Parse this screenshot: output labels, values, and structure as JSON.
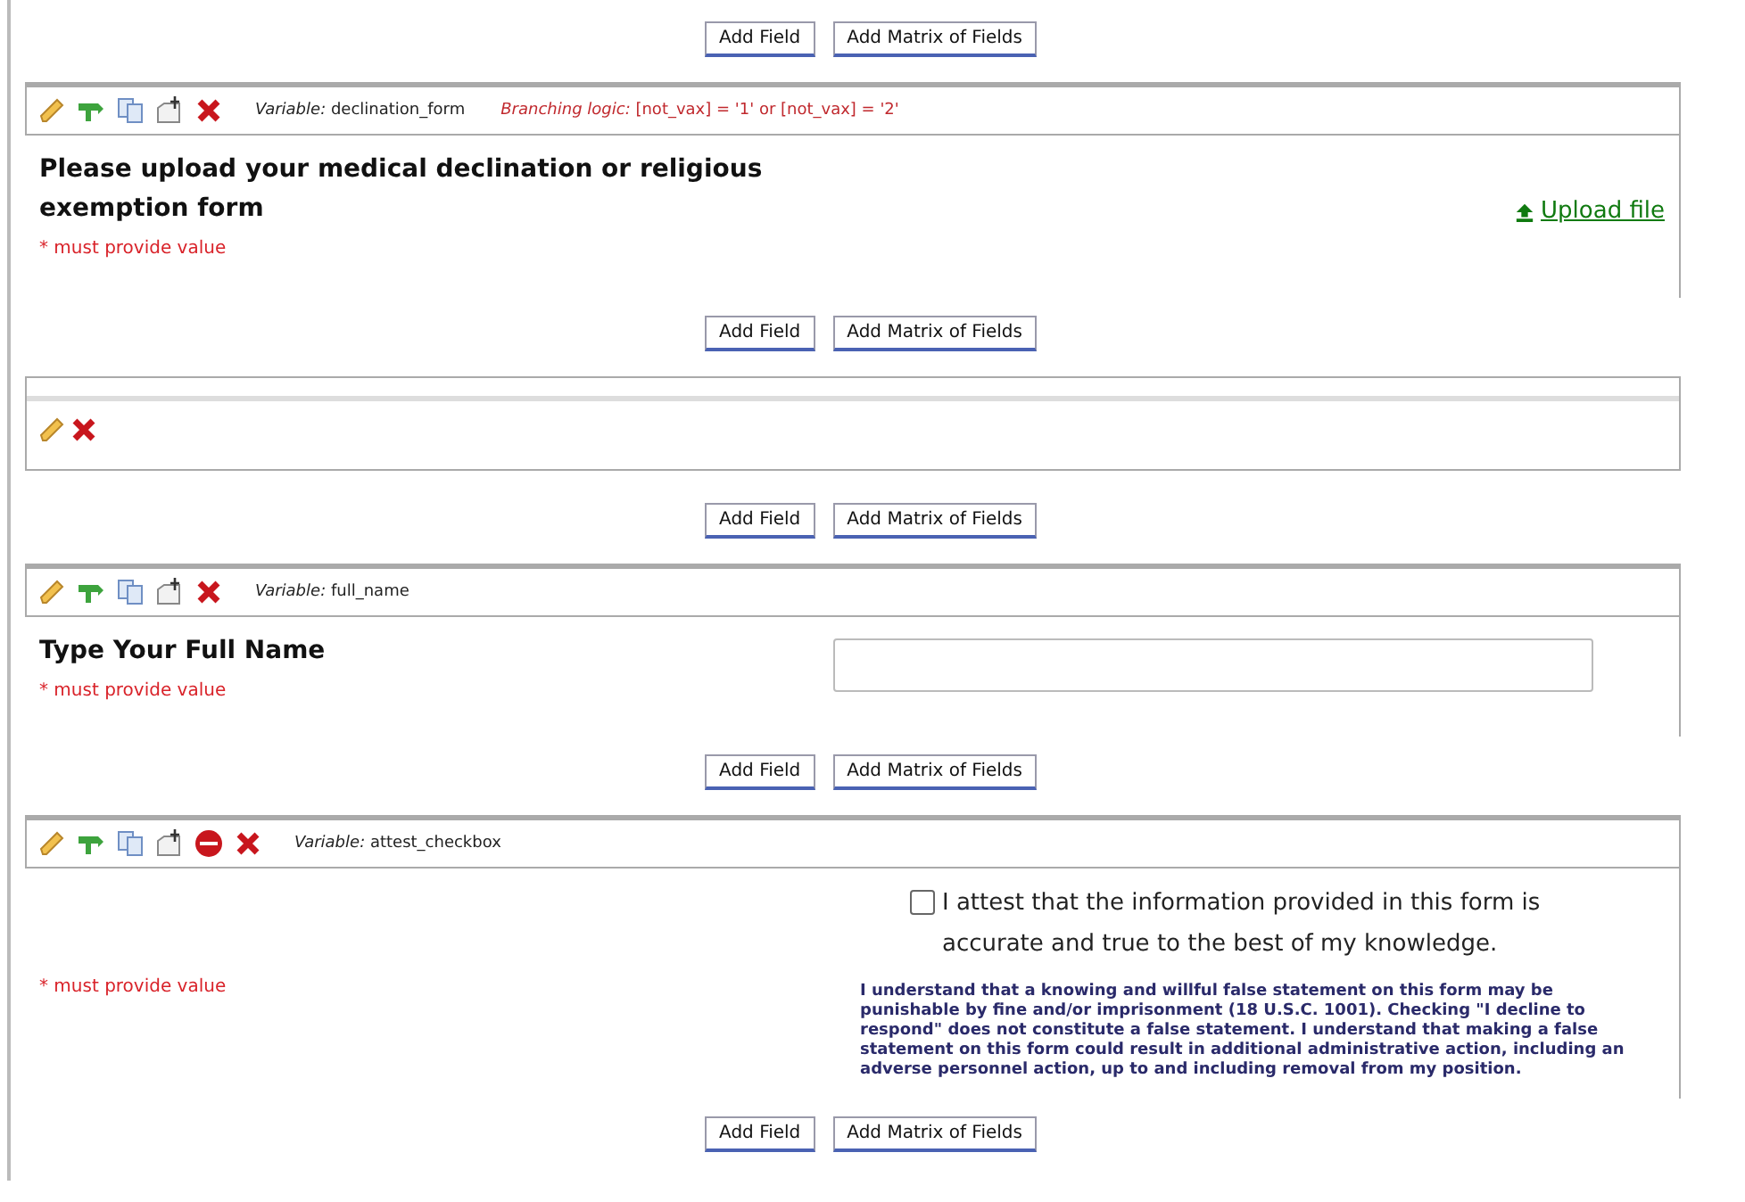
{
  "items": [
    {
      "kind": "buttons",
      "buttons": [
        "Add Field",
        "Add Matrix of Fields"
      ]
    },
    {
      "kind": "upload",
      "stop_action": false,
      "variable_label": "Variable:",
      "variable": "declination_form",
      "branching_label": "Branching logic:",
      "branching": "[not_vax] = '1' or [not_vax] = '2'",
      "label": "Please upload your medical declination or religious exemption form",
      "required": "* must provide value",
      "upload_link": "Upload file"
    },
    {
      "kind": "buttons",
      "buttons": [
        "Add Field",
        "Add Matrix of Fields"
      ]
    },
    {
      "kind": "section_header"
    },
    {
      "kind": "buttons",
      "buttons": [
        "Add Field",
        "Add Matrix of Fields"
      ]
    },
    {
      "kind": "text",
      "stop_action": false,
      "variable_label": "Variable:",
      "variable": "full_name",
      "label": "Type Your Full Name",
      "required": "* must provide value"
    },
    {
      "kind": "buttons",
      "buttons": [
        "Add Field",
        "Add Matrix of Fields"
      ]
    },
    {
      "kind": "checkbox",
      "stop_action": true,
      "variable_label": "Variable:",
      "variable": "attest_checkbox",
      "required": "* must provide value",
      "checked": false,
      "option": "I attest that the information provided in this form is accurate and true to the best of my knowledge.",
      "note": "I understand that a knowing and willful false statement on this form may be punishable by fine and/or imprisonment (18 U.S.C. 1001). Checking \"I decline to respond\" does not constitute a false statement. I understand that making a false statement on this form could result in additional administrative action, including an adverse personnel action, up to and including removal from my position."
    },
    {
      "kind": "buttons",
      "buttons": [
        "Add Field",
        "Add Matrix of Fields"
      ]
    }
  ]
}
